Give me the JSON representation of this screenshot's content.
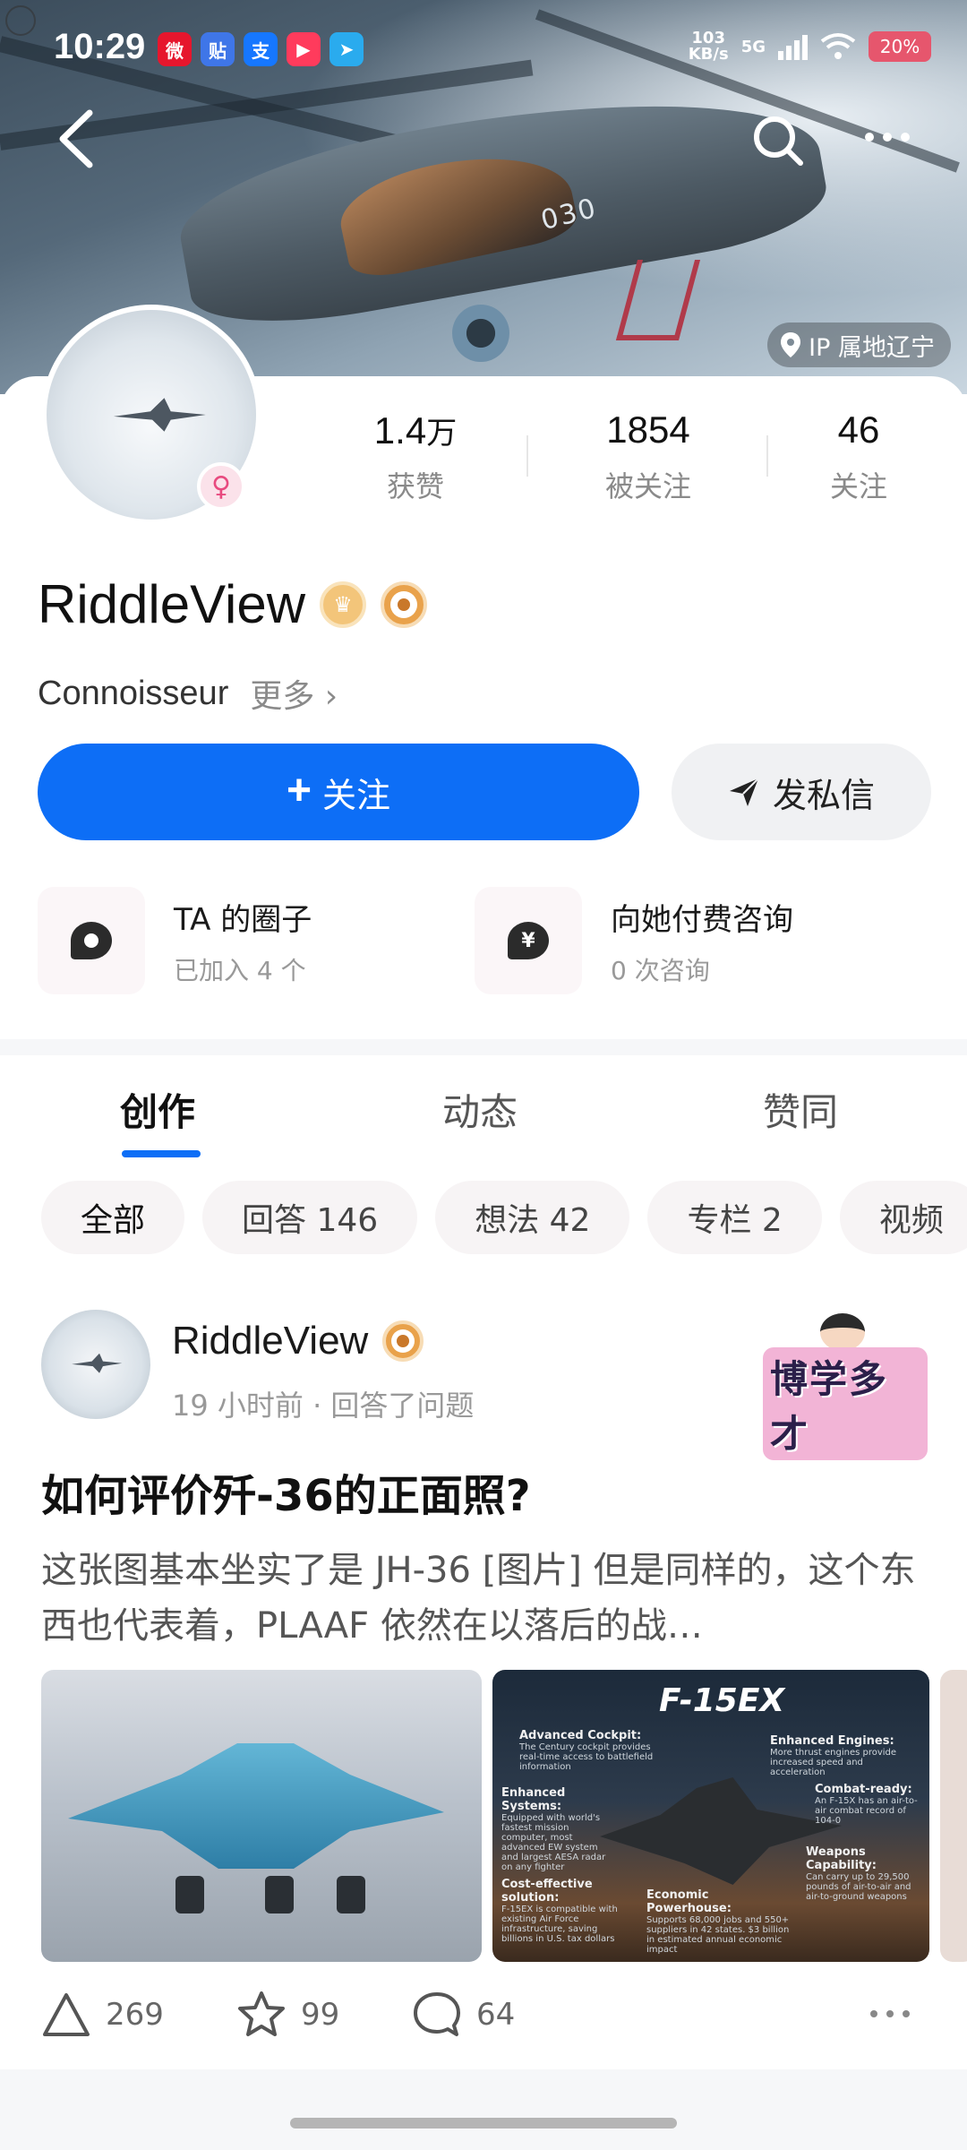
{
  "status_bar": {
    "time": "10:29",
    "net_speed_top": "103",
    "net_speed_bottom": "KB/s",
    "network": "5G",
    "battery": "20%",
    "apps": [
      {
        "icon": "weibo-icon",
        "glyph": "微",
        "color": "#e6162d"
      },
      {
        "icon": "tieba-icon",
        "glyph": "贴",
        "color": "#3f76e8"
      },
      {
        "icon": "alipay-icon",
        "glyph": "支",
        "color": "#1677ff"
      },
      {
        "icon": "video-icon",
        "glyph": "▶",
        "color": "#ff3b5c"
      },
      {
        "icon": "telegram-icon",
        "glyph": "➤",
        "color": "#2aabee"
      }
    ]
  },
  "header": {
    "ip_location": "IP 属地辽宁",
    "tail_number": "030"
  },
  "profile": {
    "name": "RiddleView",
    "bio": "Connoisseur",
    "more_label": "更多 ›",
    "gender_symbol": "♀",
    "stats": [
      {
        "num": "1.4",
        "unit": "万",
        "label": "获赞"
      },
      {
        "num": "1854",
        "unit": "",
        "label": "被关注"
      },
      {
        "num": "46",
        "unit": "",
        "label": "关注"
      }
    ],
    "follow_button": "关注",
    "follow_plus": "+",
    "message_button": "发私信",
    "entries": [
      {
        "title": "TA 的圈子",
        "subtitle": "已加入 4 个"
      },
      {
        "title": "向她付费咨询",
        "subtitle": "0 次咨询",
        "glyph": "¥"
      }
    ]
  },
  "tabs": [
    "创作",
    "动态",
    "赞同"
  ],
  "active_tab": "创作",
  "filters": [
    "全部",
    "回答 146",
    "想法 42",
    "专栏 2",
    "视频"
  ],
  "post": {
    "author": "RiddleView",
    "meta": "19 小时前 · 回答了问题",
    "sticker_text": "博学多才",
    "title": "如何评价歼-36的正面照?",
    "excerpt": "这张图基本坐实了是 JH-36 [图片] 但是同样的，这个东西也代表着，PLAAF 依然在以落后的战…",
    "image2": {
      "title": "F-15EX",
      "labels": [
        {
          "h": "Advanced Cockpit:",
          "s": "The Century cockpit provides real-time access to battlefield information"
        },
        {
          "h": "Enhanced Engines:",
          "s": "More thrust engines provide increased speed and acceleration"
        },
        {
          "h": "Enhanced Systems:",
          "s": "Equipped with world's fastest mission computer, most advanced EW system and largest AESA radar on any fighter"
        },
        {
          "h": "Combat-ready:",
          "s": "An F-15X has an air-to-air combat record of 104-0"
        },
        {
          "h": "Cost-effective solution:",
          "s": "F-15EX is compatible with existing Air Force infrastructure, saving billions in U.S. tax dollars"
        },
        {
          "h": "Weapons Capability:",
          "s": "Can carry up to 29,500 pounds of air-to-air and air-to-ground weapons"
        },
        {
          "h": "Economic Powerhouse:",
          "s": "Supports 68,000 jobs and 550+ suppliers in 42 states. $3 billion in estimated annual economic impact"
        }
      ]
    },
    "likes": "269",
    "favorites": "99",
    "comments": "64"
  },
  "colors": {
    "accent": "#0d6ef6",
    "female": "#e84a7f",
    "badge_gold": "#e9a24b"
  }
}
